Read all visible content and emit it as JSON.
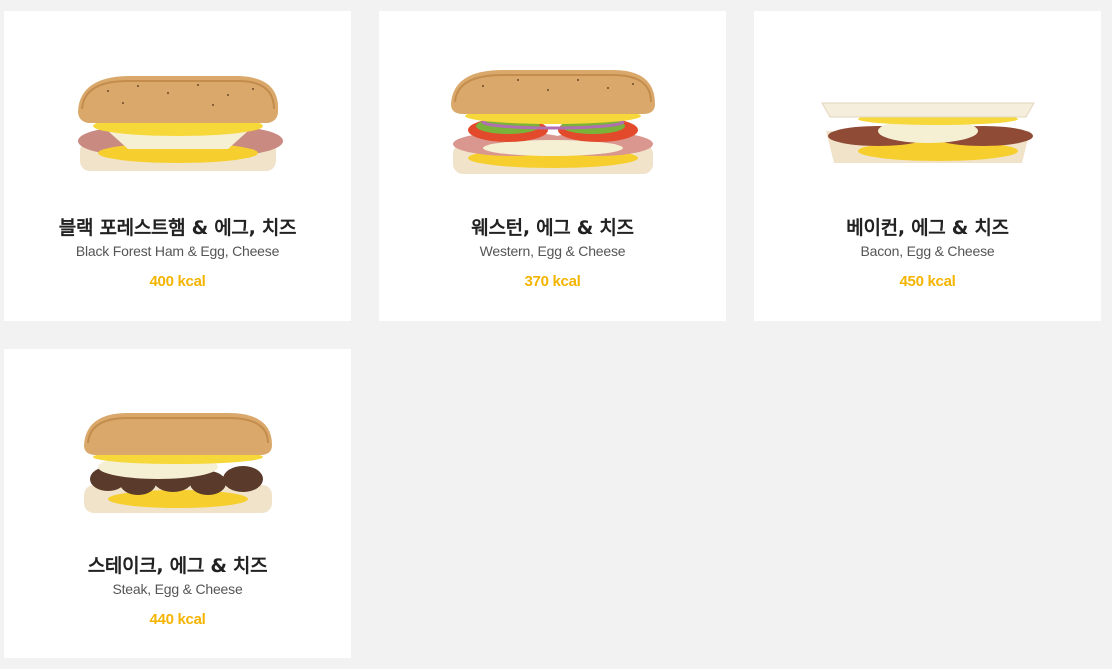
{
  "accent_color": "#f5b400",
  "menu_items": [
    {
      "name_kr": "블랙 포레스트햄 & 에그, 치즈",
      "name_en": "Black Forest Ham & Egg, Cheese",
      "kcal": "400 kcal",
      "image": "ham-egg-cheese-sandwich"
    },
    {
      "name_kr": "웨스턴, 에그 & 치즈",
      "name_en": "Western, Egg & Cheese",
      "kcal": "370 kcal",
      "image": "western-egg-cheese-sandwich"
    },
    {
      "name_kr": "베이컨, 에그 & 치즈",
      "name_en": "Bacon, Egg & Cheese",
      "kcal": "450 kcal",
      "image": "bacon-egg-cheese-flatbread"
    },
    {
      "name_kr": "스테이크, 에그 & 치즈",
      "name_en": "Steak, Egg & Cheese",
      "kcal": "440 kcal",
      "image": "steak-egg-cheese-sandwich"
    }
  ]
}
